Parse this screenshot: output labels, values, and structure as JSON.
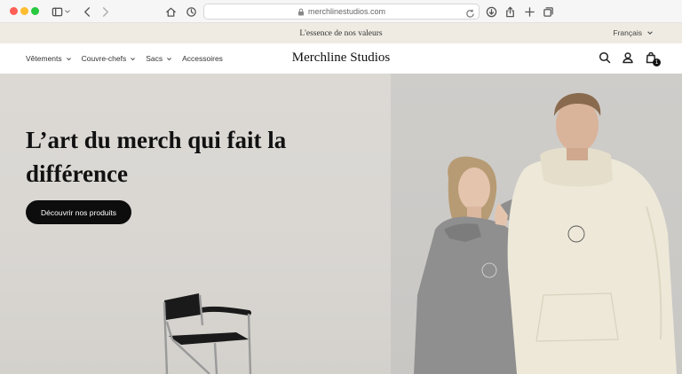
{
  "browser": {
    "url": "merchlinestudios.com"
  },
  "announcement": {
    "text": "L'essence de nos valeurs",
    "language": "Français"
  },
  "header": {
    "brand": "Merchline Studios",
    "nav": [
      {
        "label": "Vêtements",
        "has_dropdown": true
      },
      {
        "label": "Couvre-chefs",
        "has_dropdown": true
      },
      {
        "label": "Sacs",
        "has_dropdown": true
      },
      {
        "label": "Accessoires",
        "has_dropdown": false
      }
    ],
    "cart_count": "1"
  },
  "hero": {
    "title": "L’art du merch qui fait la différence",
    "cta_label": "Découvrir nos produits"
  },
  "colors": {
    "announcement_bg": "#efebe3",
    "cta_bg": "#0d0d0d",
    "hero_left_bg": "#dcd9d5",
    "hero_right_bg": "#cfcdca"
  }
}
